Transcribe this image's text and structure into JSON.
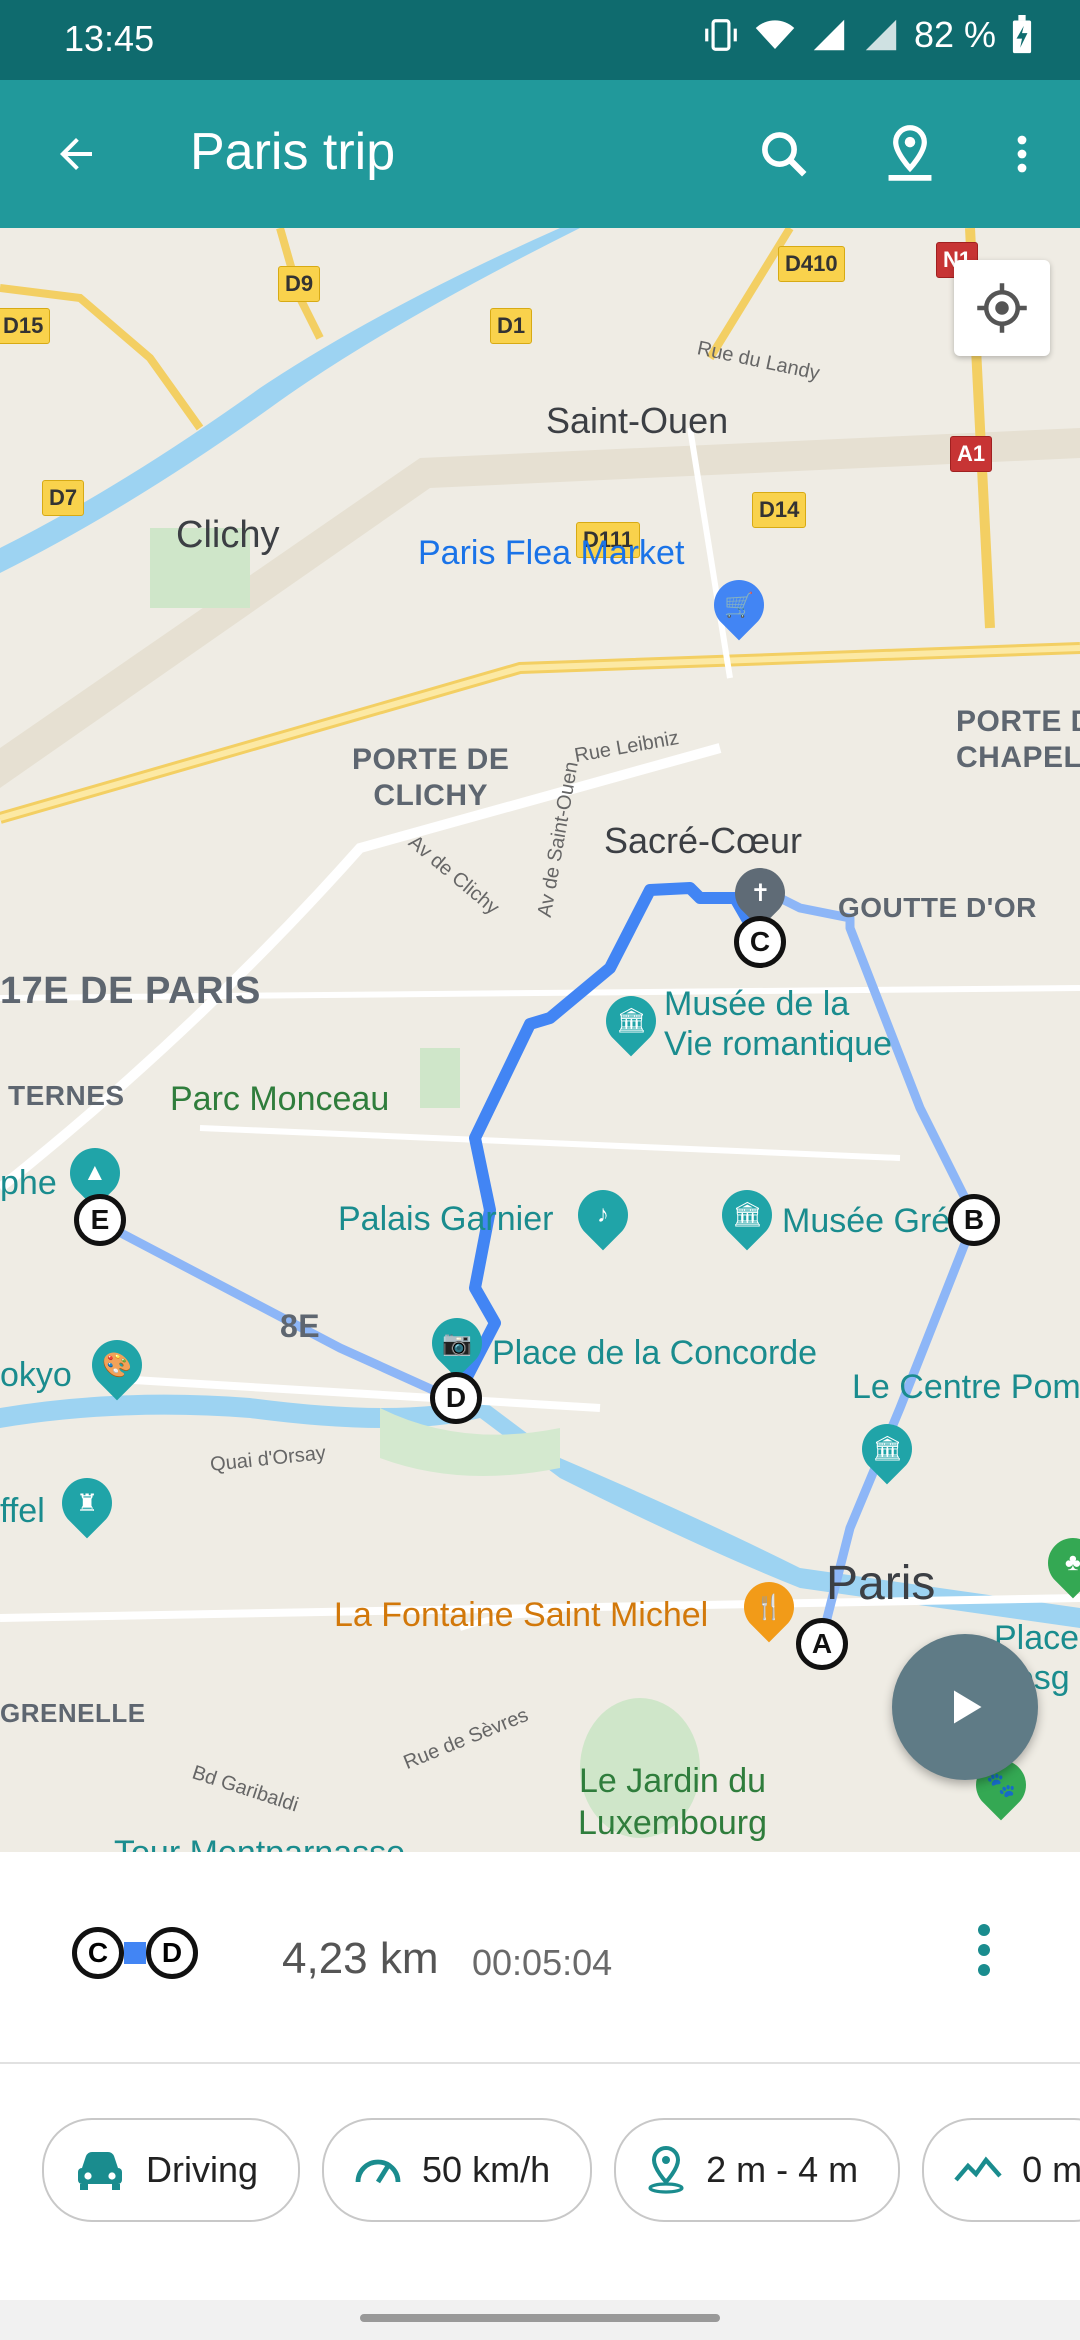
{
  "status": {
    "time": "13:45",
    "battery": "82 %"
  },
  "appbar": {
    "title": "Paris trip"
  },
  "map": {
    "places": {
      "saint_ouen": "Saint-Ouen",
      "clichy": "Clichy",
      "flea_market": "Paris Flea Market",
      "porte_clichy": "PORTE DE\nCLICHY",
      "porte_chapelle": "PORTE DE\nCHAPEL",
      "sacre_coeur": "Sacré-Cœur",
      "goutte": "GOUTTE D'OR",
      "arrond": "17E DE PARIS",
      "ternes": "TERNES",
      "parc_monceau": "Parc Monceau",
      "musee_vie": "Musée de la\nVie romantique",
      "palais_garnier": "Palais Garnier",
      "musee_gre": "Musée Gré",
      "phe": "phe",
      "eightE": "8E",
      "concorde": "Place de la Concorde",
      "tokyo": "okyo",
      "centre_pom": "Le Centre Pom",
      "quai_orsay": "Quai d'Orsay",
      "ffel": "ffel",
      "paris": "Paris",
      "fontaine": "La Fontaine Saint Michel",
      "place_vosges": "Place\nVosg",
      "grenelle": "GRENELLE",
      "rue_sevres": "Rue de Sèvres",
      "bd_garibaldi": "Bd Garibaldi",
      "jardin_lux": "Le Jardin du\nLuxembourg",
      "montparnasse": "Tour Montparnasse",
      "rue_landy": "Rue du Landy",
      "rue_leibniz": "Rue Leibniz",
      "av_st_ouen": "Av de Saint-Ouen",
      "av_clichy": "Av de Clichy"
    },
    "roads": {
      "d9": "D9",
      "d15": "D15",
      "d1": "D1",
      "d410": "D410",
      "d7": "D7",
      "d111": "D111",
      "d14": "D14",
      "a1": "A1",
      "n1": "N1"
    },
    "waypoints": {
      "a": "A",
      "b": "B",
      "c": "C",
      "d": "D",
      "e": "E"
    },
    "route_color": "#4285f4",
    "route_faded_color": "#8db6f7"
  },
  "segment": {
    "from": "C",
    "to": "D",
    "distance": "4,23 km",
    "duration": "00:05:04"
  },
  "chips": [
    {
      "icon": "car-icon",
      "label": "Driving"
    },
    {
      "icon": "speedometer-icon",
      "label": "50 km/h"
    },
    {
      "icon": "location-pin-icon",
      "label": "2 m - 4 m"
    },
    {
      "icon": "elevation-icon",
      "label": "0 m"
    }
  ],
  "colors": {
    "status_bar": "#0f6b6e",
    "app_bar": "#21999b",
    "accent": "#1a8c8e"
  }
}
